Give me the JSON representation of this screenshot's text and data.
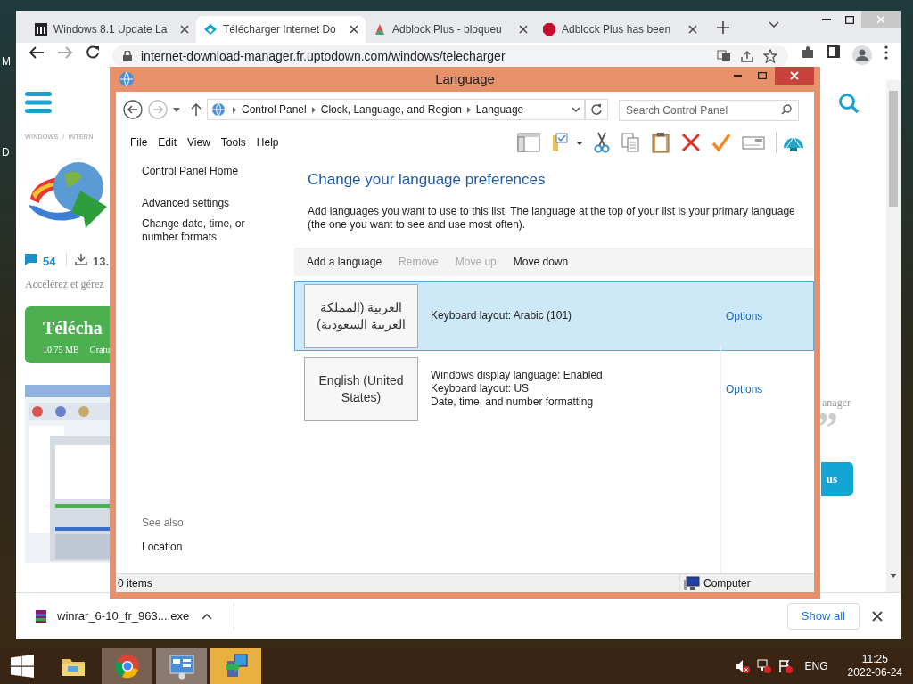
{
  "desktop_labels": [
    "M",
    "D"
  ],
  "browser": {
    "tabs": [
      {
        "title": "Windows 8.1 Update La",
        "kind": "museum",
        "selected": false
      },
      {
        "title": "Télécharger Internet Do",
        "kind": "uptodown",
        "selected": true
      },
      {
        "title": "Adblock Plus - bloqueu",
        "kind": "store",
        "selected": false
      },
      {
        "title": "Adblock Plus has been",
        "kind": "abp",
        "selected": false
      }
    ],
    "url": "internet-download-manager.fr.uptodown.com/windows/telecharger"
  },
  "page": {
    "breadcrumb": "WINDOWS  /  INTERN",
    "comments": "54",
    "downloads": "13.",
    "description": "Accélérez et gérez",
    "download_button": {
      "label": "Télécha",
      "size": "10.75 MB",
      "license": "Gratu"
    },
    "side_text": "anager",
    "quote": "”",
    "side_button": "us"
  },
  "download_bar": {
    "file": "winrar_6-10_fr_963....exe",
    "show_all": "Show all"
  },
  "language_window": {
    "title": "Language",
    "breadcrumb": [
      "Control Panel",
      "Clock, Language, and Region",
      "Language"
    ],
    "search": {
      "placeholder": "Search Control Panel"
    },
    "menu": [
      "File",
      "Edit",
      "View",
      "Tools",
      "Help"
    ],
    "sidebar": {
      "links": [
        "Control Panel Home",
        "Advanced settings",
        "Change date, time, or number formats"
      ],
      "see_also": "See also",
      "see_also_links": [
        "Location"
      ]
    },
    "heading": "Change your language preferences",
    "description": "Add languages you want to use to this list. The language at the top of your list is your primary language (the one you want to see and use most often).",
    "actions": [
      {
        "label": "Add a language",
        "disabled": false
      },
      {
        "label": "Remove",
        "disabled": true
      },
      {
        "label": "Move up",
        "disabled": true
      },
      {
        "label": "Move down",
        "disabled": false
      }
    ],
    "languages": [
      {
        "name": "العربية (المملكة العربية السعودية)",
        "details": [
          "Keyboard layout: Arabic (101)"
        ],
        "options": "Options",
        "selected": true
      },
      {
        "name": "English (United States)",
        "details": [
          "Windows display language: Enabled",
          "Keyboard layout: US",
          "Date, time, and number formatting"
        ],
        "options": "Options",
        "selected": false
      }
    ],
    "status": {
      "items": "0 items",
      "zone": "Computer"
    }
  },
  "taskbar": {
    "apps": [
      {
        "kind": "explorer"
      },
      {
        "kind": "chrome"
      },
      {
        "kind": "control-panel"
      },
      {
        "kind": "installer"
      }
    ],
    "language": "ENG",
    "time": "11:25",
    "date": "2022-06-24"
  }
}
